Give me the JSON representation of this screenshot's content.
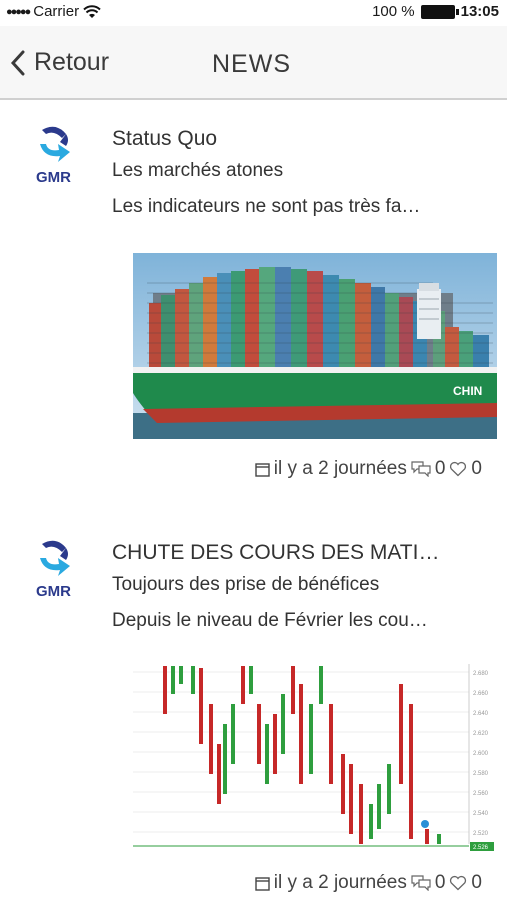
{
  "status_bar": {
    "carrier": "Carrier",
    "battery_percent": "100 %",
    "time": "13:05"
  },
  "nav": {
    "back_label": "Retour",
    "title": "NEWS"
  },
  "news": [
    {
      "logo_text": "GMR",
      "title": "Status Quo",
      "subtitle": "Les marchés atones",
      "excerpt": "Les indicateurs ne sont pas très fa…",
      "image": "container-ship-photo",
      "time_label": "il y a 2 journées",
      "comments": "0",
      "likes": "0"
    },
    {
      "logo_text": "GMR",
      "title": "CHUTE DES COURS DES MATI…",
      "subtitle": "Toujours des prise de bénéfices",
      "excerpt": "Depuis le niveau de Février les cou…",
      "image": "candlestick-chart-screenshot",
      "time_label": "il y a 2 journées",
      "comments": "0",
      "likes": "0"
    }
  ],
  "chart_thumbnail": {
    "axis_labels": [
      "2.680",
      "2.660",
      "2.640",
      "2.620",
      "2.600",
      "2.580",
      "2.560",
      "2.540",
      "2.520"
    ],
    "current_price_label": "2.526"
  },
  "colors": {
    "accent_green": "#2e9e3e",
    "candle_red": "#c62828",
    "logo_blue": "#2b3a8c",
    "logo_cyan": "#2aa9e0"
  }
}
